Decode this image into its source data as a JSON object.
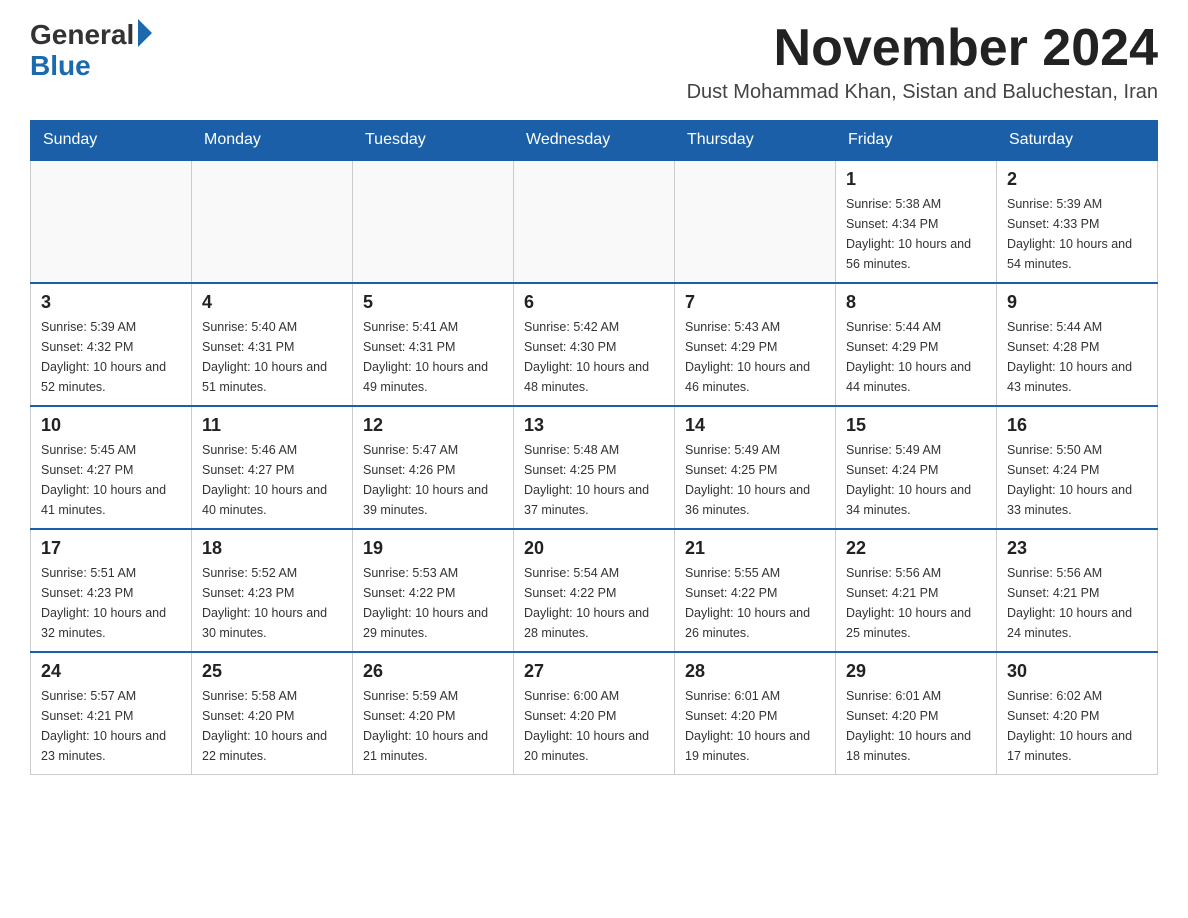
{
  "logo": {
    "general": "General",
    "blue": "Blue"
  },
  "title": "November 2024",
  "subtitle": "Dust Mohammad Khan, Sistan and Baluchestan, Iran",
  "days_of_week": [
    "Sunday",
    "Monday",
    "Tuesday",
    "Wednesday",
    "Thursday",
    "Friday",
    "Saturday"
  ],
  "weeks": [
    [
      {
        "day": "",
        "info": ""
      },
      {
        "day": "",
        "info": ""
      },
      {
        "day": "",
        "info": ""
      },
      {
        "day": "",
        "info": ""
      },
      {
        "day": "",
        "info": ""
      },
      {
        "day": "1",
        "info": "Sunrise: 5:38 AM\nSunset: 4:34 PM\nDaylight: 10 hours and 56 minutes."
      },
      {
        "day": "2",
        "info": "Sunrise: 5:39 AM\nSunset: 4:33 PM\nDaylight: 10 hours and 54 minutes."
      }
    ],
    [
      {
        "day": "3",
        "info": "Sunrise: 5:39 AM\nSunset: 4:32 PM\nDaylight: 10 hours and 52 minutes."
      },
      {
        "day": "4",
        "info": "Sunrise: 5:40 AM\nSunset: 4:31 PM\nDaylight: 10 hours and 51 minutes."
      },
      {
        "day": "5",
        "info": "Sunrise: 5:41 AM\nSunset: 4:31 PM\nDaylight: 10 hours and 49 minutes."
      },
      {
        "day": "6",
        "info": "Sunrise: 5:42 AM\nSunset: 4:30 PM\nDaylight: 10 hours and 48 minutes."
      },
      {
        "day": "7",
        "info": "Sunrise: 5:43 AM\nSunset: 4:29 PM\nDaylight: 10 hours and 46 minutes."
      },
      {
        "day": "8",
        "info": "Sunrise: 5:44 AM\nSunset: 4:29 PM\nDaylight: 10 hours and 44 minutes."
      },
      {
        "day": "9",
        "info": "Sunrise: 5:44 AM\nSunset: 4:28 PM\nDaylight: 10 hours and 43 minutes."
      }
    ],
    [
      {
        "day": "10",
        "info": "Sunrise: 5:45 AM\nSunset: 4:27 PM\nDaylight: 10 hours and 41 minutes."
      },
      {
        "day": "11",
        "info": "Sunrise: 5:46 AM\nSunset: 4:27 PM\nDaylight: 10 hours and 40 minutes."
      },
      {
        "day": "12",
        "info": "Sunrise: 5:47 AM\nSunset: 4:26 PM\nDaylight: 10 hours and 39 minutes."
      },
      {
        "day": "13",
        "info": "Sunrise: 5:48 AM\nSunset: 4:25 PM\nDaylight: 10 hours and 37 minutes."
      },
      {
        "day": "14",
        "info": "Sunrise: 5:49 AM\nSunset: 4:25 PM\nDaylight: 10 hours and 36 minutes."
      },
      {
        "day": "15",
        "info": "Sunrise: 5:49 AM\nSunset: 4:24 PM\nDaylight: 10 hours and 34 minutes."
      },
      {
        "day": "16",
        "info": "Sunrise: 5:50 AM\nSunset: 4:24 PM\nDaylight: 10 hours and 33 minutes."
      }
    ],
    [
      {
        "day": "17",
        "info": "Sunrise: 5:51 AM\nSunset: 4:23 PM\nDaylight: 10 hours and 32 minutes."
      },
      {
        "day": "18",
        "info": "Sunrise: 5:52 AM\nSunset: 4:23 PM\nDaylight: 10 hours and 30 minutes."
      },
      {
        "day": "19",
        "info": "Sunrise: 5:53 AM\nSunset: 4:22 PM\nDaylight: 10 hours and 29 minutes."
      },
      {
        "day": "20",
        "info": "Sunrise: 5:54 AM\nSunset: 4:22 PM\nDaylight: 10 hours and 28 minutes."
      },
      {
        "day": "21",
        "info": "Sunrise: 5:55 AM\nSunset: 4:22 PM\nDaylight: 10 hours and 26 minutes."
      },
      {
        "day": "22",
        "info": "Sunrise: 5:56 AM\nSunset: 4:21 PM\nDaylight: 10 hours and 25 minutes."
      },
      {
        "day": "23",
        "info": "Sunrise: 5:56 AM\nSunset: 4:21 PM\nDaylight: 10 hours and 24 minutes."
      }
    ],
    [
      {
        "day": "24",
        "info": "Sunrise: 5:57 AM\nSunset: 4:21 PM\nDaylight: 10 hours and 23 minutes."
      },
      {
        "day": "25",
        "info": "Sunrise: 5:58 AM\nSunset: 4:20 PM\nDaylight: 10 hours and 22 minutes."
      },
      {
        "day": "26",
        "info": "Sunrise: 5:59 AM\nSunset: 4:20 PM\nDaylight: 10 hours and 21 minutes."
      },
      {
        "day": "27",
        "info": "Sunrise: 6:00 AM\nSunset: 4:20 PM\nDaylight: 10 hours and 20 minutes."
      },
      {
        "day": "28",
        "info": "Sunrise: 6:01 AM\nSunset: 4:20 PM\nDaylight: 10 hours and 19 minutes."
      },
      {
        "day": "29",
        "info": "Sunrise: 6:01 AM\nSunset: 4:20 PM\nDaylight: 10 hours and 18 minutes."
      },
      {
        "day": "30",
        "info": "Sunrise: 6:02 AM\nSunset: 4:20 PM\nDaylight: 10 hours and 17 minutes."
      }
    ]
  ]
}
